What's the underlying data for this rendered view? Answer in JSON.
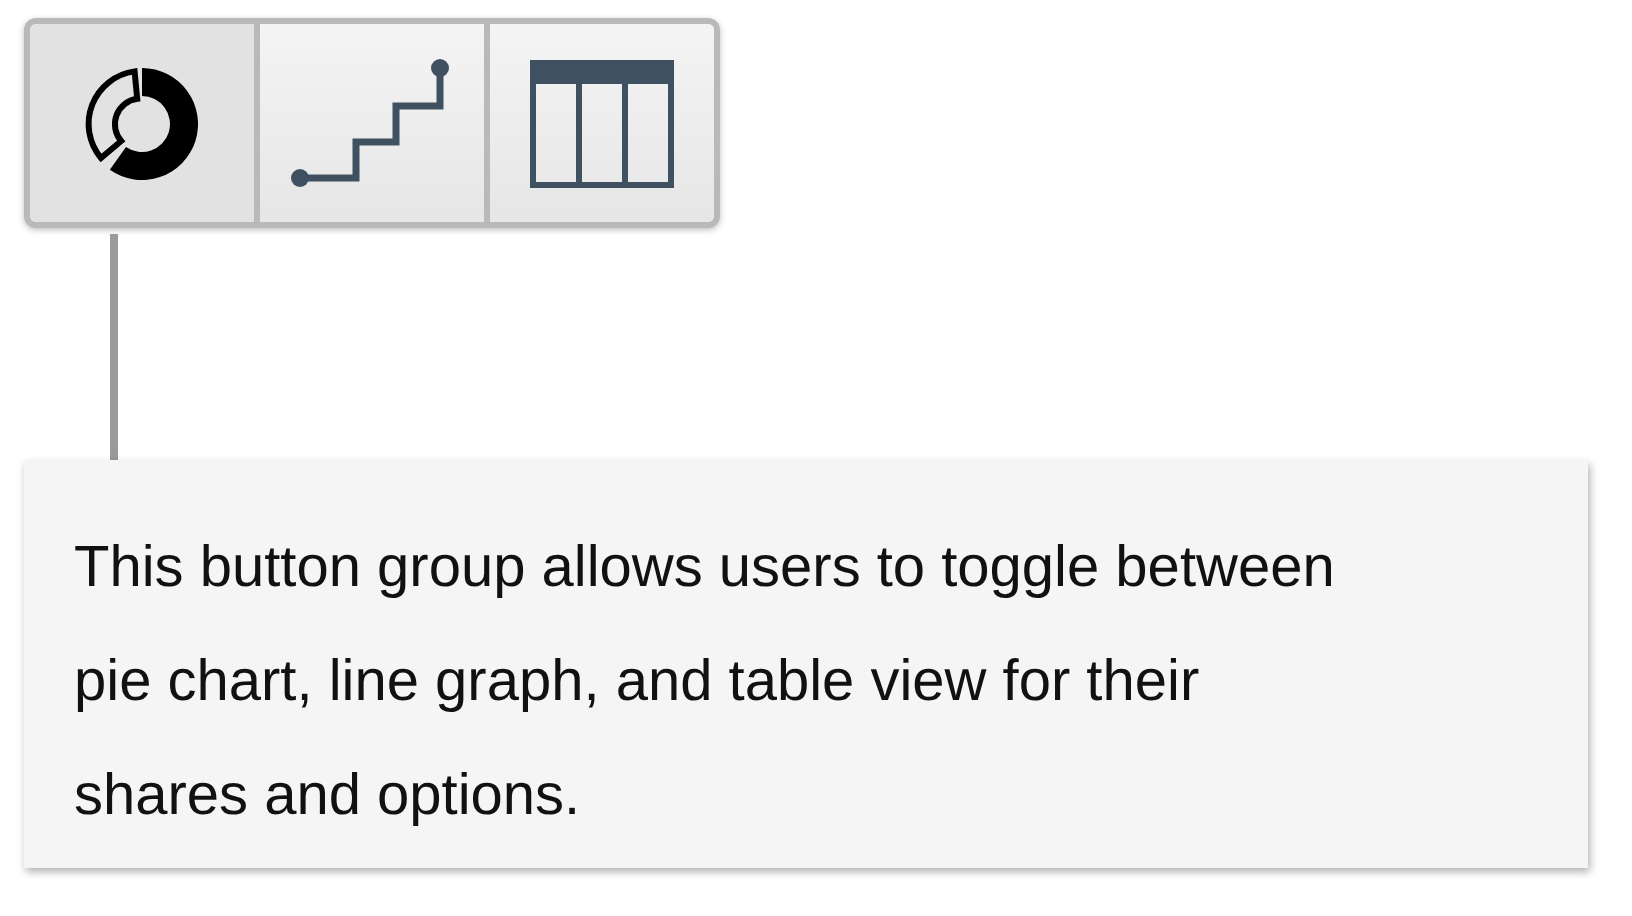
{
  "view_buttons": [
    {
      "kind": "pie",
      "selected": true
    },
    {
      "kind": "line",
      "selected": false
    },
    {
      "kind": "table",
      "selected": false
    }
  ],
  "callout": {
    "text": "This button group allows users to toggle between pie chart, line graph, and table view for their shares and options."
  }
}
